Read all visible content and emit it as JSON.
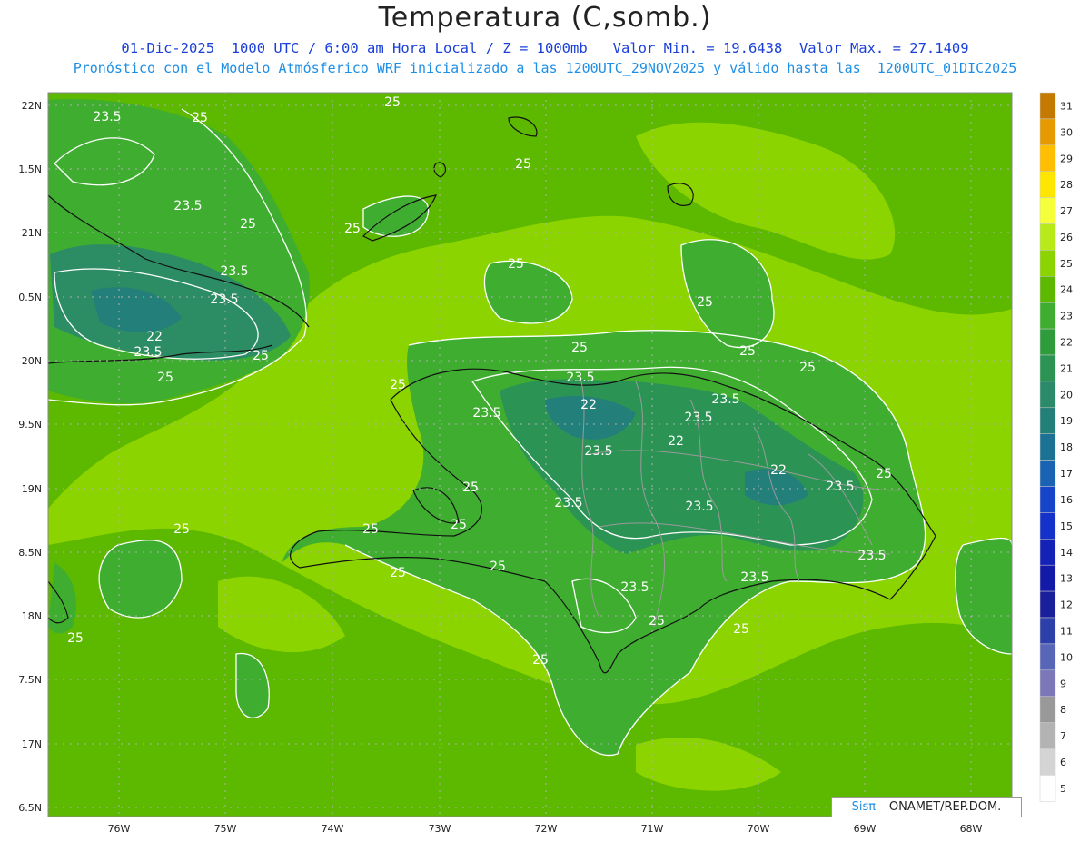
{
  "header": {
    "title": "Temperatura (C,somb.)",
    "line1": "01-Dic-2025  1000 UTC / 6:00 am Hora Local / Z = 1000mb   Valor Min. = 19.6438  Valor Max. = 27.1409",
    "line2": "Pronóstico con el Modelo Atmósferico WRF inicializado a las 1200UTC_29NOV2025 y válido hasta las  1200UTC_01DIC2025"
  },
  "axes": {
    "lat_labels": [
      "22N",
      "1.5N",
      "21N",
      "0.5N",
      "20N",
      "9.5N",
      "19N",
      "8.5N",
      "18N",
      "7.5N",
      "17N",
      "6.5N"
    ],
    "lon_labels": [
      "76W",
      "75W",
      "74W",
      "73W",
      "72W",
      "71W",
      "70W",
      "69W",
      "68W"
    ]
  },
  "colorbar": {
    "labels": [
      "31",
      "30",
      "29",
      "28",
      "27",
      "26",
      "25",
      "24",
      "23",
      "22",
      "21",
      "20",
      "19",
      "18",
      "17",
      "16",
      "15",
      "14",
      "13",
      "12",
      "11",
      "10",
      "9",
      "8",
      "7",
      "6",
      "5"
    ],
    "colors": [
      "#c47a00",
      "#e69a00",
      "#ffbf00",
      "#ffe600",
      "#f5ff3a",
      "#b8ea1a",
      "#8cd400",
      "#5db800",
      "#3fae30",
      "#2f9c3c",
      "#2b9454",
      "#2a8a6a",
      "#237f7a",
      "#1c7294",
      "#1a63b3",
      "#1745c9",
      "#1431c9",
      "#1422b8",
      "#141aa8",
      "#1a1f9a",
      "#2d3fa8",
      "#5866b8",
      "#7a78b8",
      "#999999",
      "#b3b3b3",
      "#d4d4d4",
      "#ffffff"
    ]
  },
  "contour_labels": [
    {
      "text": "25"
    },
    {
      "text": "25"
    },
    {
      "text": "23.5"
    },
    {
      "text": "25"
    },
    {
      "text": "23.5"
    },
    {
      "text": "25"
    },
    {
      "text": "25"
    },
    {
      "text": "23.5"
    },
    {
      "text": "23.5"
    },
    {
      "text": "22"
    },
    {
      "text": "23.5"
    },
    {
      "text": "25"
    },
    {
      "text": "25"
    },
    {
      "text": "25"
    },
    {
      "text": "25"
    },
    {
      "text": "25"
    },
    {
      "text": "25"
    },
    {
      "text": "25"
    },
    {
      "text": "23.5"
    },
    {
      "text": "22"
    },
    {
      "text": "23.5"
    },
    {
      "text": "23.5"
    },
    {
      "text": "22"
    },
    {
      "text": "23.5"
    },
    {
      "text": "23.5"
    },
    {
      "text": "23.5"
    },
    {
      "text": "22"
    },
    {
      "text": "23.5"
    },
    {
      "text": "25"
    },
    {
      "text": "23.5"
    },
    {
      "text": "23.5"
    },
    {
      "text": "25"
    },
    {
      "text": "25"
    },
    {
      "text": "25"
    },
    {
      "text": "25"
    },
    {
      "text": "25"
    },
    {
      "text": "23.5"
    },
    {
      "text": "25"
    },
    {
      "text": "23.5"
    },
    {
      "text": "25"
    },
    {
      "text": "25"
    },
    {
      "text": "25"
    },
    {
      "text": "25"
    },
    {
      "text": "25"
    }
  ],
  "credit": {
    "logo": "Sisπ",
    "text": "– ONAMET/REP.DOM."
  }
}
